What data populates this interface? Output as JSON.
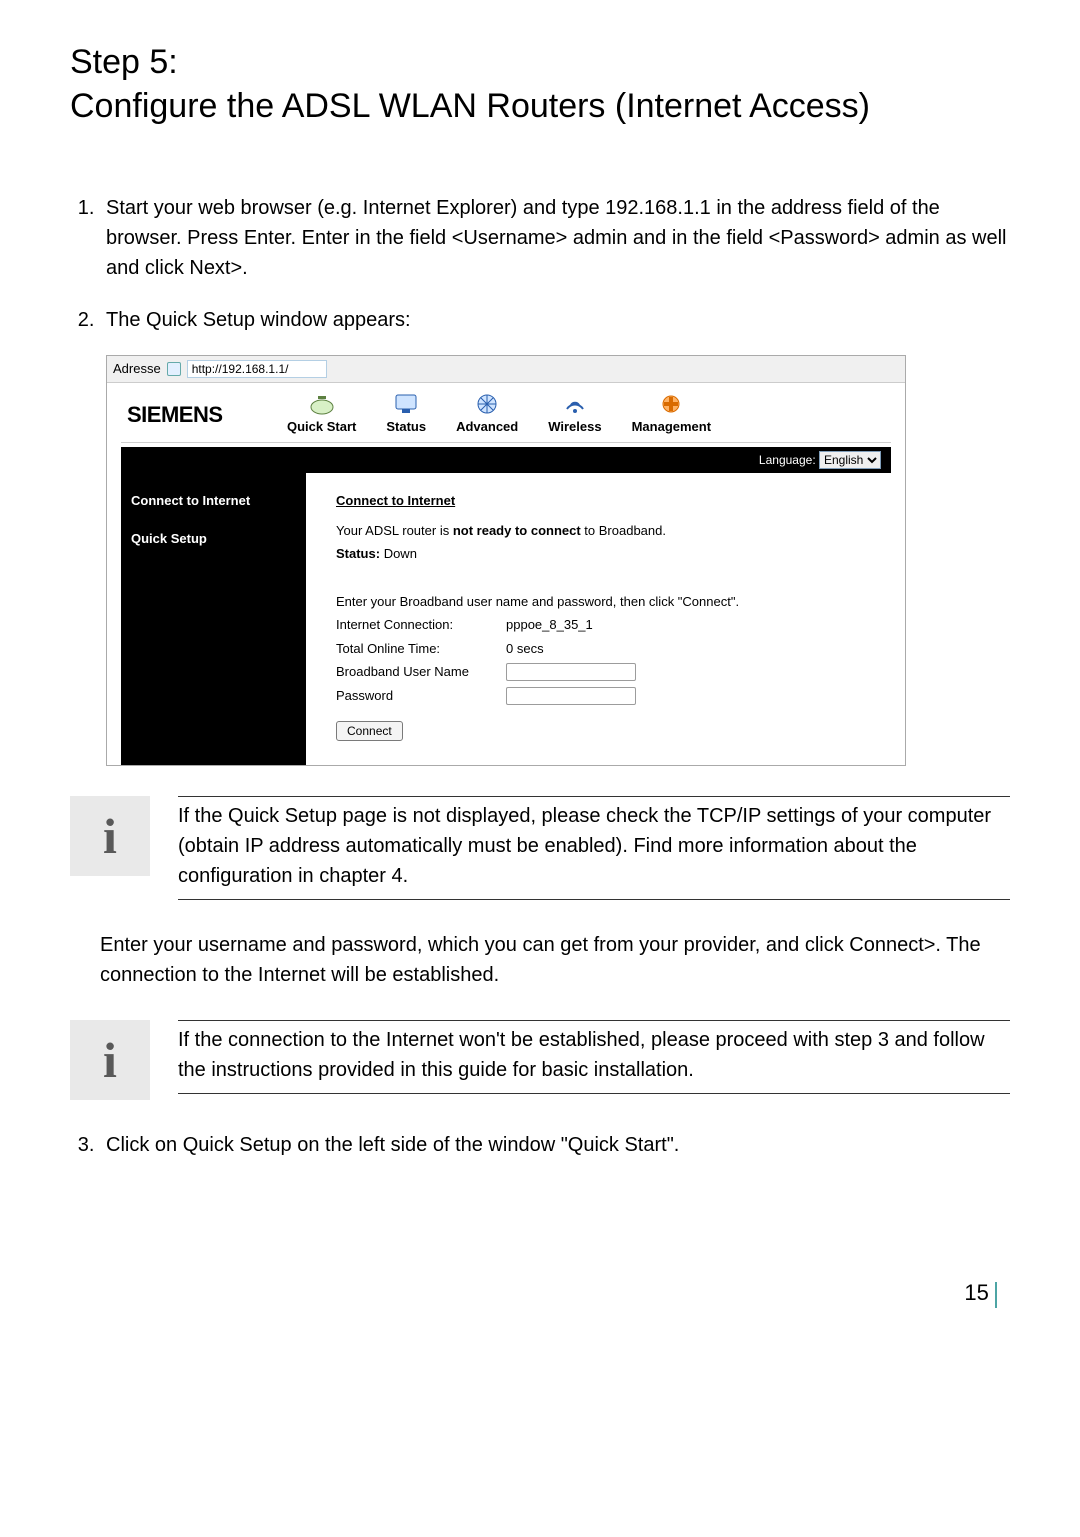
{
  "heading_line1": "Step 5:",
  "heading_line2": "Configure the ADSL WLAN Routers (Internet Access)",
  "steps": {
    "s1": "Start your web browser (e.g. Internet Explorer) and type 192.168.1.1 in the address field of the browser. Press Enter. Enter in the field <Username> admin and in the field <Password> admin as well and click Next>.",
    "s2": "The Quick Setup window appears:",
    "s3": "Click on Quick Setup on the left side of the window \"Quick Start\"."
  },
  "screenshot": {
    "address_label": "Adresse",
    "address_value": "http://192.168.1.1/",
    "brand": "SIEMENS",
    "nav": {
      "quick_start": "Quick Start",
      "status": "Status",
      "advanced": "Advanced",
      "wireless": "Wireless",
      "management": "Management"
    },
    "language_label": "Language:",
    "language_value": "English",
    "sidebar": {
      "connect": "Connect to Internet",
      "quick_setup": "Quick Setup"
    },
    "content": {
      "section_title": "Connect to Internet",
      "status_line_prefix": "Your ADSL router is ",
      "status_line_bold": "not ready to connect",
      "status_line_suffix": " to Broadband.",
      "status_label": "Status:",
      "status_value": "Down",
      "instructions": "Enter your Broadband user name and password, then click \"Connect\".",
      "internet_conn_label": "Internet Connection:",
      "internet_conn_value": "pppoe_8_35_1",
      "online_time_label": "Total Online Time:",
      "online_time_value": "0 secs",
      "username_label": "Broadband User Name",
      "password_label": "Password",
      "connect_button": "Connect"
    }
  },
  "info1": "If the Quick Setup page is not displayed, please check the TCP/IP settings of your computer (obtain IP address automatically must be enabled). Find more information about the configuration in chapter 4.",
  "middle_para": "Enter your username and password, which you can get from your provider, and click Connect>. The connection to the Internet will be established.",
  "info2": "If the connection to the Internet won't be established, please proceed with step 3 and follow the instructions provided in this guide for basic installation.",
  "page_number": "15"
}
